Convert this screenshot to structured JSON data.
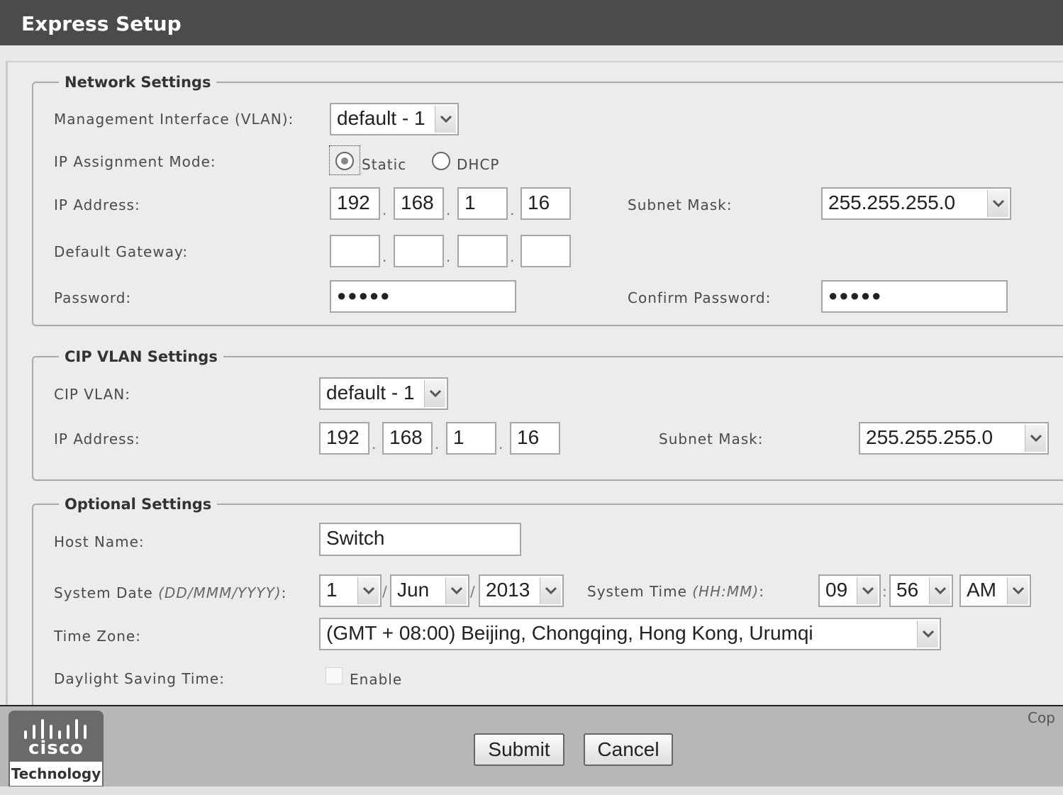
{
  "window": {
    "title": "Express Setup"
  },
  "network": {
    "legend": "Network Settings",
    "mgmt_label": "Management Interface (VLAN):",
    "mgmt_value": "default - 1",
    "ip_mode_label": "IP Assignment Mode:",
    "static_label": "Static",
    "dhcp_label": "DHCP",
    "ip_mode_selected": "Static",
    "ip_label": "IP Address:",
    "ip": [
      "192",
      "168",
      "1",
      "16"
    ],
    "subnet_label": "Subnet Mask:",
    "subnet_value": "255.255.255.0",
    "gateway_label": "Default Gateway:",
    "gateway": [
      "",
      "",
      "",
      ""
    ],
    "password_label": "Password:",
    "password_value": "●●●●●",
    "confirm_label": "Confirm Password:",
    "confirm_value": "●●●●●"
  },
  "cip": {
    "legend": "CIP VLAN Settings",
    "vlan_label": "CIP VLAN:",
    "vlan_value": "default - 1",
    "ip_label": "IP Address:",
    "ip": [
      "192",
      "168",
      "1",
      "16"
    ],
    "subnet_label": "Subnet Mask:",
    "subnet_value": "255.255.255.0"
  },
  "optional": {
    "legend": "Optional Settings",
    "hostname_label": "Host Name:",
    "hostname_value": "Switch",
    "date_label": "System Date",
    "date_format": "(DD/MMM/YYYY)",
    "date_day": "1",
    "date_month": "Jun",
    "date_year": "2013",
    "time_label": "System Time",
    "time_format": "(HH:MM)",
    "time_hour": "09",
    "time_minute": "56",
    "time_ampm": "AM",
    "timezone_label": "Time Zone:",
    "timezone_value": "(GMT + 08:00) Beijing, Chongqing, Hong Kong, Urumqi",
    "dst_label": "Daylight Saving Time:",
    "dst_enable_label": "Enable",
    "dst_checked": false
  },
  "footer": {
    "logo_text": "cisco",
    "logo_sub": "Technology",
    "submit_label": "Submit",
    "cancel_label": "Cancel",
    "copyright_fragment": "Cop"
  },
  "icons": {
    "dropdown": "chevron-down-icon",
    "logo": "cisco-bars-icon"
  }
}
